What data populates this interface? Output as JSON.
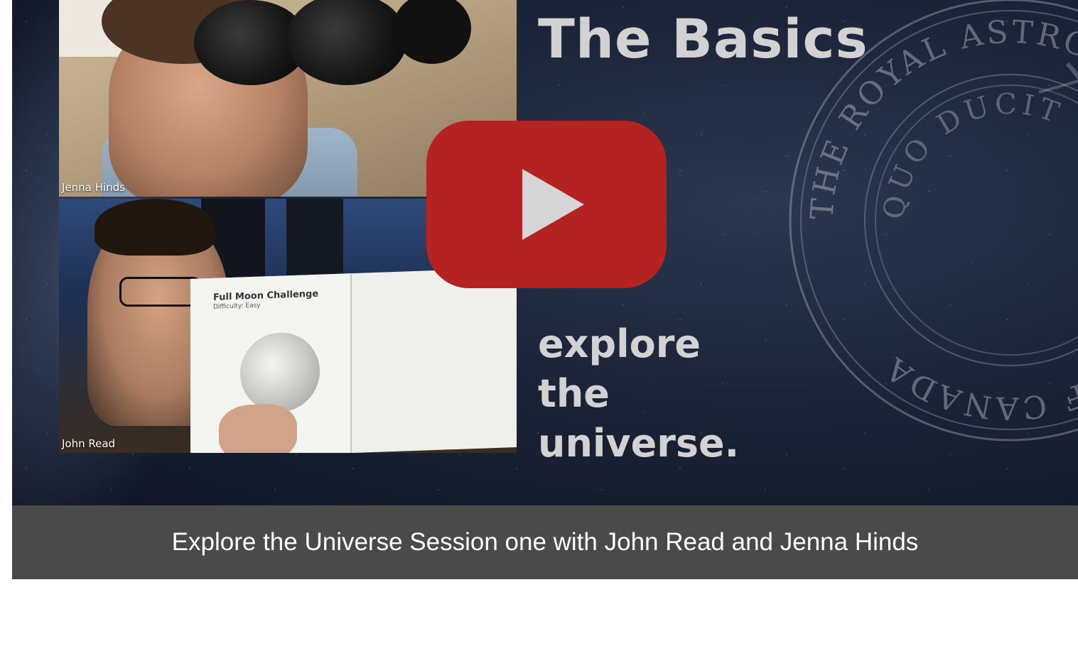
{
  "video": {
    "title_overlay": "The Basics",
    "tagline": [
      "explore",
      "the",
      "universe."
    ],
    "participants": [
      {
        "name": "Jenna Hinds"
      },
      {
        "name": "John Read"
      }
    ],
    "book_title": "Full Moon Challenge",
    "book_subtitle": "Difficulty: Easy",
    "play_button_color": "#b42222",
    "seal_text": "THE ROYAL ASTRONOMICAL SOCIETY OF CANADA",
    "seal_motto": "QUO DUCIT"
  },
  "caption": {
    "text": "Explore the Universe Session one with John Read and Jenna Hinds",
    "background": "#4a4a4a"
  },
  "icons": {
    "play": "play-icon"
  }
}
